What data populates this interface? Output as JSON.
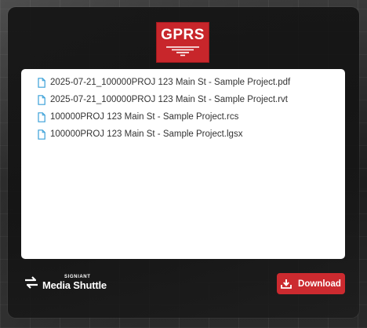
{
  "logo": {
    "text": "GPRS"
  },
  "files": [
    {
      "name": "2025-07-21_100000PROJ 123 Main St - Sample Project.pdf",
      "icon": "document-icon"
    },
    {
      "name": "2025-07-21_100000PROJ 123 Main St - Sample Project.rvt",
      "icon": "document-icon"
    },
    {
      "name": "100000PROJ 123 Main St - Sample Project.rcs",
      "icon": "document-icon"
    },
    {
      "name": "100000PROJ 123 Main St - Sample Project.lgsx",
      "icon": "document-icon"
    }
  ],
  "brand": {
    "vendor": "SIGNIANT",
    "product": "Media Shuttle"
  },
  "download": {
    "label": "Download",
    "icon": "download-icon"
  },
  "colors": {
    "accent": "#cc2a2f",
    "file_icon": "#3aa0d8",
    "panel": "#ffffff"
  }
}
